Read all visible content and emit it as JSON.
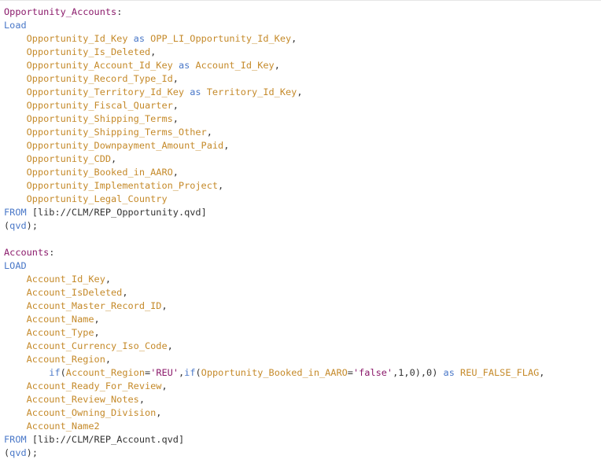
{
  "editor": {
    "colors": {
      "label": "#8b1a6b",
      "keyword": "#4a78c8",
      "field": "#c58a2a",
      "text": "#333333",
      "background": "#ffffff"
    },
    "lines": [
      [
        {
          "t": "Opportunity_Accounts",
          "c": "label"
        },
        {
          "t": ":",
          "c": "punct"
        }
      ],
      [
        {
          "t": "Load",
          "c": "keyword"
        }
      ],
      [
        {
          "t": "    "
        },
        {
          "t": "Opportunity_Id_Key",
          "c": "field"
        },
        {
          "t": " "
        },
        {
          "t": "as",
          "c": "keyword"
        },
        {
          "t": " "
        },
        {
          "t": "OPP_LI_Opportunity_Id_Key",
          "c": "field"
        },
        {
          "t": ",",
          "c": "punct"
        }
      ],
      [
        {
          "t": "    "
        },
        {
          "t": "Opportunity_Is_Deleted",
          "c": "field"
        },
        {
          "t": ",",
          "c": "punct"
        }
      ],
      [
        {
          "t": "    "
        },
        {
          "t": "Opportunity_Account_Id_Key",
          "c": "field"
        },
        {
          "t": " "
        },
        {
          "t": "as",
          "c": "keyword"
        },
        {
          "t": " "
        },
        {
          "t": "Account_Id_Key",
          "c": "field"
        },
        {
          "t": ",",
          "c": "punct"
        }
      ],
      [
        {
          "t": "    "
        },
        {
          "t": "Opportunity_Record_Type_Id",
          "c": "field"
        },
        {
          "t": ",",
          "c": "punct"
        }
      ],
      [
        {
          "t": "    "
        },
        {
          "t": "Opportunity_Territory_Id_Key",
          "c": "field"
        },
        {
          "t": " "
        },
        {
          "t": "as",
          "c": "keyword"
        },
        {
          "t": " "
        },
        {
          "t": "Territory_Id_Key",
          "c": "field"
        },
        {
          "t": ",",
          "c": "punct"
        }
      ],
      [
        {
          "t": "    "
        },
        {
          "t": "Opportunity_Fiscal_Quarter",
          "c": "field"
        },
        {
          "t": ",",
          "c": "punct"
        }
      ],
      [
        {
          "t": "    "
        },
        {
          "t": "Opportunity_Shipping_Terms",
          "c": "field"
        },
        {
          "t": ",",
          "c": "punct"
        }
      ],
      [
        {
          "t": "    "
        },
        {
          "t": "Opportunity_Shipping_Terms_Other",
          "c": "field"
        },
        {
          "t": ",",
          "c": "punct"
        }
      ],
      [
        {
          "t": "    "
        },
        {
          "t": "Opportunity_Downpayment_Amount_Paid",
          "c": "field"
        },
        {
          "t": ",",
          "c": "punct"
        }
      ],
      [
        {
          "t": "    "
        },
        {
          "t": "Opportunity_CDD",
          "c": "field"
        },
        {
          "t": ",",
          "c": "punct"
        }
      ],
      [
        {
          "t": "    "
        },
        {
          "t": "Opportunity_Booked_in_AARO",
          "c": "field"
        },
        {
          "t": ",",
          "c": "punct"
        }
      ],
      [
        {
          "t": "    "
        },
        {
          "t": "Opportunity_Implementation_Project",
          "c": "field"
        },
        {
          "t": ",",
          "c": "punct"
        }
      ],
      [
        {
          "t": "    "
        },
        {
          "t": "Opportunity_Legal_Country",
          "c": "field"
        }
      ],
      [
        {
          "t": "FROM",
          "c": "keyword"
        },
        {
          "t": " "
        },
        {
          "t": "[lib://CLM/REP_Opportunity.qvd]",
          "c": "path"
        }
      ],
      [
        {
          "t": "(",
          "c": "punct"
        },
        {
          "t": "qvd",
          "c": "keyword"
        },
        {
          "t": ");",
          "c": "punct"
        }
      ],
      [
        {
          "t": ""
        }
      ],
      [
        {
          "t": "Accounts",
          "c": "label"
        },
        {
          "t": ":",
          "c": "punct"
        }
      ],
      [
        {
          "t": "LOAD",
          "c": "keyword"
        }
      ],
      [
        {
          "t": "    "
        },
        {
          "t": "Account_Id_Key",
          "c": "field"
        },
        {
          "t": ",",
          "c": "punct"
        }
      ],
      [
        {
          "t": "    "
        },
        {
          "t": "Account_IsDeleted",
          "c": "field"
        },
        {
          "t": ",",
          "c": "punct"
        }
      ],
      [
        {
          "t": "    "
        },
        {
          "t": "Account_Master_Record_ID",
          "c": "field"
        },
        {
          "t": ",",
          "c": "punct"
        }
      ],
      [
        {
          "t": "    "
        },
        {
          "t": "Account_Name",
          "c": "field"
        },
        {
          "t": ",",
          "c": "punct"
        }
      ],
      [
        {
          "t": "    "
        },
        {
          "t": "Account_Type",
          "c": "field"
        },
        {
          "t": ",",
          "c": "punct"
        }
      ],
      [
        {
          "t": "    "
        },
        {
          "t": "Account_Currency_Iso_Code",
          "c": "field"
        },
        {
          "t": ",",
          "c": "punct"
        }
      ],
      [
        {
          "t": "    "
        },
        {
          "t": "Account_Region",
          "c": "field"
        },
        {
          "t": ",",
          "c": "punct"
        }
      ],
      [
        {
          "t": "        "
        },
        {
          "t": "if",
          "c": "func"
        },
        {
          "t": "(",
          "c": "punct"
        },
        {
          "t": "Account_Region",
          "c": "field"
        },
        {
          "t": "=",
          "c": "punct"
        },
        {
          "t": "'REU'",
          "c": "string"
        },
        {
          "t": ",",
          "c": "punct"
        },
        {
          "t": "if",
          "c": "func"
        },
        {
          "t": "(",
          "c": "punct"
        },
        {
          "t": "Opportunity_Booked_in_AARO",
          "c": "field"
        },
        {
          "t": "=",
          "c": "punct"
        },
        {
          "t": "'false'",
          "c": "string"
        },
        {
          "t": ",1,0),0)",
          "c": "number"
        },
        {
          "t": " "
        },
        {
          "t": "as",
          "c": "keyword"
        },
        {
          "t": " "
        },
        {
          "t": "REU_FALSE_FLAG",
          "c": "field"
        },
        {
          "t": ",",
          "c": "punct"
        }
      ],
      [
        {
          "t": "    "
        },
        {
          "t": "Account_Ready_For_Review",
          "c": "field"
        },
        {
          "t": ",",
          "c": "punct"
        }
      ],
      [
        {
          "t": "    "
        },
        {
          "t": "Account_Review_Notes",
          "c": "field"
        },
        {
          "t": ",",
          "c": "punct"
        }
      ],
      [
        {
          "t": "    "
        },
        {
          "t": "Account_Owning_Division",
          "c": "field"
        },
        {
          "t": ",",
          "c": "punct"
        }
      ],
      [
        {
          "t": "    "
        },
        {
          "t": "Account_Name2",
          "c": "field"
        }
      ],
      [
        {
          "t": "FROM",
          "c": "keyword"
        },
        {
          "t": " "
        },
        {
          "t": "[lib://CLM/REP_Account.qvd]",
          "c": "path"
        }
      ],
      [
        {
          "t": "(",
          "c": "punct"
        },
        {
          "t": "qvd",
          "c": "keyword"
        },
        {
          "t": ");",
          "c": "punct"
        }
      ]
    ]
  }
}
